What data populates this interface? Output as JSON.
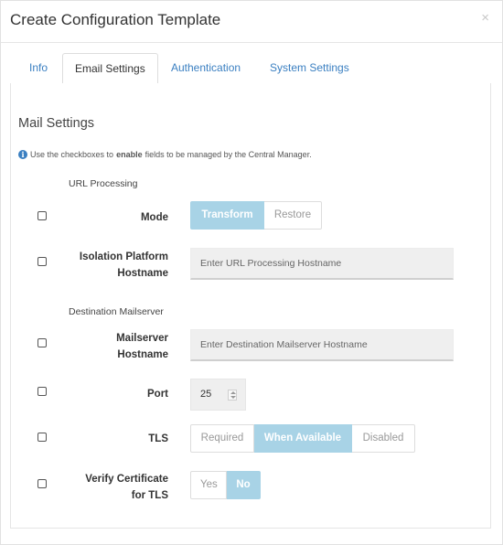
{
  "modal": {
    "title": "Create Configuration Template",
    "close_glyph": "×"
  },
  "tabs": [
    {
      "label": "Info",
      "active": false
    },
    {
      "label": "Email Settings",
      "active": true
    },
    {
      "label": "Authentication",
      "active": false
    },
    {
      "label": "System Settings",
      "active": false
    }
  ],
  "section": {
    "title": "Mail Settings",
    "hint_pre": "Use the checkboxes to",
    "hint_bold": "enable",
    "hint_post": "fields to be managed by the Central Manager.",
    "info_icon": "i"
  },
  "url_processing": {
    "group_label": "URL Processing",
    "mode": {
      "label": "Mode",
      "options": [
        "Transform",
        "Restore"
      ],
      "selected": "Transform"
    },
    "isolation_hostname": {
      "label_line1": "Isolation Platform",
      "label_line2": "Hostname",
      "placeholder": "Enter URL Processing Hostname"
    }
  },
  "destination": {
    "group_label": "Destination Mailserver",
    "mailserver_hostname": {
      "label_line1": "Mailserver",
      "label_line2": "Hostname",
      "placeholder": "Enter Destination Mailserver Hostname"
    },
    "port": {
      "label": "Port",
      "value": "25"
    },
    "tls": {
      "label": "TLS",
      "options": [
        "Required",
        "When Available",
        "Disabled"
      ],
      "selected": "When Available"
    },
    "verify_cert": {
      "label_line1": "Verify Certificate",
      "label_line2": "for TLS",
      "options": [
        "Yes",
        "No"
      ],
      "selected": "No"
    }
  },
  "colors": {
    "accent": "#3a7fc1",
    "selected_option": "#a8d3e6"
  }
}
